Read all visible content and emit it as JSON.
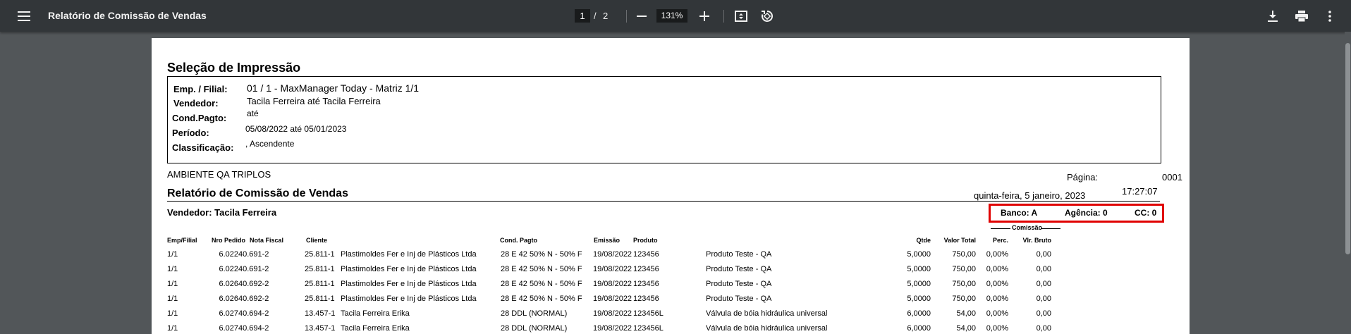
{
  "toolbar": {
    "title": "Relatório de Comissão de Vendas",
    "page_current": "1",
    "page_sep": "/",
    "page_total": "2",
    "zoom": "131%",
    "icons": [
      "menu-icon",
      "zoom-out-icon",
      "zoom-in-icon",
      "fit-page-icon",
      "rotate-icon",
      "download-icon",
      "print-icon",
      "more-vert-icon"
    ]
  },
  "report": {
    "selecao_title": "Seleção de Impressão",
    "fields": [
      {
        "label": "Emp. / Filial:",
        "value": "01 / 1 - MaxManager Today - Matriz 1/1"
      },
      {
        "label": "Vendedor:",
        "value": "Tacila Ferreira até Tacila Ferreira"
      },
      {
        "label": "Cond.Pagto:",
        "value": "até"
      },
      {
        "label": "Período:",
        "value": "05/08/2022 até 05/01/2023"
      },
      {
        "label": "Classificação:",
        "value": ", Ascendente"
      }
    ],
    "ambiente": "AMBIENTE QA TRIPLOS",
    "report_title": "Relatório de Comissão de Vendas",
    "pagina_label": "Página:",
    "pagina_value": "0001",
    "date": "quinta-feira, 5 janeiro, 2023",
    "time": "17:27:07",
    "vendedor": "Vendedor: Tacila Ferreira",
    "banco": "Banco: A",
    "agencia": "Agência: 0",
    "cc": "CC: 0",
    "comissao_label": "Comissão",
    "columns": [
      "Emp/Filial",
      "Nro Pedido",
      "Nota Fiscal",
      "Cliente",
      "Cond. Pagto",
      "Emissão",
      "Produto",
      "Qtde",
      "Valor Total",
      "Perc.",
      "Vlr. Bruto"
    ],
    "rows": [
      {
        "emp": "1/1",
        "pedido": "6.022",
        "nota": "40.691-2",
        "cliente_cod": "25.811-1",
        "cliente": "Plastimoldes Fer e Inj de Plásticos Ltda",
        "cond": "28 E 42 50% N - 50% F",
        "emissao": "19/08/2022",
        "produto_cod": "123456",
        "produto": "Produto Teste - QA",
        "qtde": "5,0000",
        "valor": "750,00",
        "perc": "0,00%",
        "bruto": "0,00"
      },
      {
        "emp": "1/1",
        "pedido": "6.022",
        "nota": "40.691-2",
        "cliente_cod": "25.811-1",
        "cliente": "Plastimoldes Fer e Inj de Plásticos Ltda",
        "cond": "28 E 42 50% N - 50% F",
        "emissao": "19/08/2022",
        "produto_cod": "123456",
        "produto": "Produto Teste - QA",
        "qtde": "5,0000",
        "valor": "750,00",
        "perc": "0,00%",
        "bruto": "0,00"
      },
      {
        "emp": "1/1",
        "pedido": "6.026",
        "nota": "40.692-2",
        "cliente_cod": "25.811-1",
        "cliente": "Plastimoldes Fer e Inj de Plásticos Ltda",
        "cond": "28 E 42 50% N - 50% F",
        "emissao": "19/08/2022",
        "produto_cod": "123456",
        "produto": "Produto Teste - QA",
        "qtde": "5,0000",
        "valor": "750,00",
        "perc": "0,00%",
        "bruto": "0,00"
      },
      {
        "emp": "1/1",
        "pedido": "6.026",
        "nota": "40.692-2",
        "cliente_cod": "25.811-1",
        "cliente": "Plastimoldes Fer e Inj de Plásticos Ltda",
        "cond": "28 E 42 50% N - 50% F",
        "emissao": "19/08/2022",
        "produto_cod": "123456",
        "produto": "Produto Teste - QA",
        "qtde": "5,0000",
        "valor": "750,00",
        "perc": "0,00%",
        "bruto": "0,00"
      },
      {
        "emp": "1/1",
        "pedido": "6.027",
        "nota": "40.694-2",
        "cliente_cod": "13.457-1",
        "cliente": "Tacila Ferreira Erika",
        "cond": "28 DDL (NORMAL)",
        "emissao": "19/08/2022",
        "produto_cod": "123456L",
        "produto": "Válvula de bóia hidráulica universal",
        "qtde": "6,0000",
        "valor": "54,00",
        "perc": "0,00%",
        "bruto": "0,00"
      },
      {
        "emp": "1/1",
        "pedido": "6.027",
        "nota": "40.694-2",
        "cliente_cod": "13.457-1",
        "cliente": "Tacila Ferreira Erika",
        "cond": "28 DDL (NORMAL)",
        "emissao": "19/08/2022",
        "produto_cod": "123456L",
        "produto": "Válvula de bóia hidráulica universal",
        "qtde": "6,0000",
        "valor": "54,00",
        "perc": "0,00%",
        "bruto": "0,00"
      }
    ]
  }
}
